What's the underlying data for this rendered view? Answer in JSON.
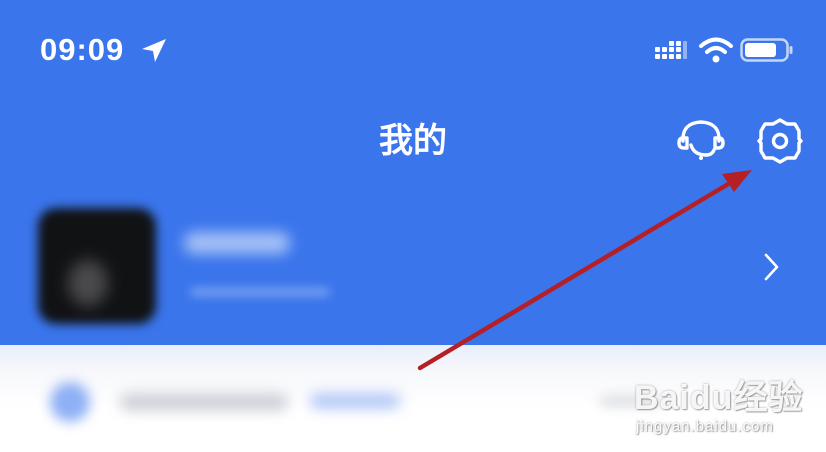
{
  "status_bar": {
    "time": "09:09",
    "icons": [
      "location-arrow-icon",
      "cellular-signal-icon",
      "wifi-icon",
      "battery-icon"
    ]
  },
  "header": {
    "title": "我的",
    "actions": [
      {
        "icon": "customer-service-icon"
      },
      {
        "icon": "settings-gear-icon"
      }
    ]
  },
  "profile": {
    "avatar": "avatar",
    "chevron_icon": "chevron-right-icon"
  },
  "colors": {
    "header_blue": "#3a75ec",
    "annotation_arrow": "#b42025",
    "text_on_blue": "#ffffff"
  },
  "watermark": {
    "main": "Baidu经验",
    "sub": "jingyan.baidu.com"
  }
}
